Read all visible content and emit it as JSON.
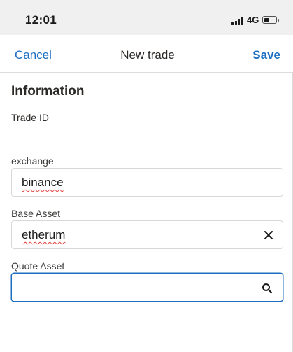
{
  "status_bar": {
    "time": "12:01",
    "network": "4G",
    "battery_level": 0.45,
    "icons": [
      "signal-icon",
      "battery-icon"
    ]
  },
  "nav": {
    "cancel_label": "Cancel",
    "title": "New trade",
    "save_label": "Save",
    "accent_color": "#1b6ec2"
  },
  "form": {
    "section_title": "Information",
    "trade_id_label": "Trade ID",
    "exchange": {
      "label": "exchange",
      "value": "binance"
    },
    "base_asset": {
      "label": "Base Asset",
      "value": "etherum",
      "action_icon": "close-icon"
    },
    "quote_asset": {
      "label": "Quote Asset",
      "value": "",
      "action_icon": "search-icon"
    }
  }
}
